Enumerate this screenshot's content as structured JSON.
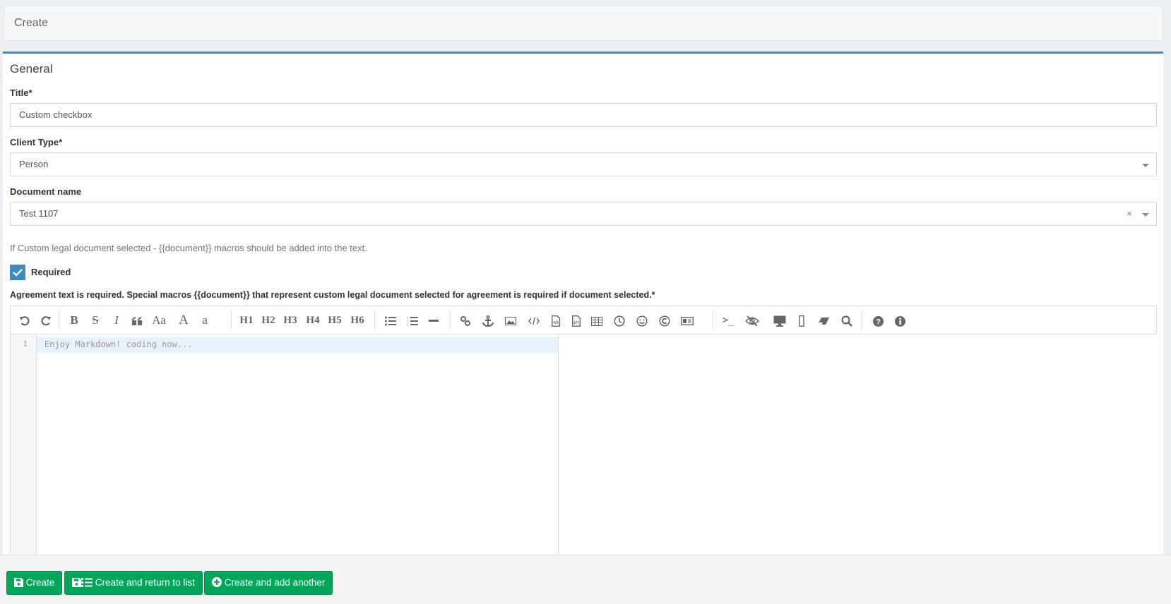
{
  "header": {
    "title": "Create"
  },
  "box": {
    "title": "General"
  },
  "form": {
    "title": {
      "label": "Title*",
      "value": "Custom checkbox"
    },
    "client_type": {
      "label": "Client Type*",
      "value": "Person"
    },
    "document_name": {
      "label": "Document name",
      "value": "Test 1107",
      "clear_glyph": "×",
      "help": "If Custom legal document selected - {{document}} macros should be added into the text."
    },
    "required": {
      "label": "Required",
      "checked": true
    },
    "agreement": {
      "label": "Agreement text is required. Special macros {{document}} that represent custom legal document selected for agreement is required if document selected.*"
    }
  },
  "editor": {
    "toolbar": [
      {
        "name": "undo-icon"
      },
      {
        "name": "redo-icon"
      },
      {
        "name": "bold-icon",
        "text": "B"
      },
      {
        "name": "strikethrough-icon",
        "text": "S"
      },
      {
        "name": "italic-icon",
        "text": "I"
      },
      {
        "name": "quote-icon"
      },
      {
        "name": "uppercase-icon",
        "text": "Aa"
      },
      {
        "name": "ucwords-icon",
        "text": "A"
      },
      {
        "name": "lowercase-icon",
        "text": "a"
      },
      {
        "name": "h1-icon",
        "text": "H1"
      },
      {
        "name": "h2-icon",
        "text": "H2"
      },
      {
        "name": "h3-icon",
        "text": "H3"
      },
      {
        "name": "h4-icon",
        "text": "H4"
      },
      {
        "name": "h5-icon",
        "text": "H5"
      },
      {
        "name": "h6-icon",
        "text": "H6"
      },
      {
        "name": "unordered-list-icon"
      },
      {
        "name": "ordered-list-icon"
      },
      {
        "name": "horizontal-rule-icon"
      },
      {
        "name": "link-icon"
      },
      {
        "name": "anchor-icon"
      },
      {
        "name": "image-icon"
      },
      {
        "name": "inline-code-icon"
      },
      {
        "name": "code-block-icon"
      },
      {
        "name": "preformatted-text-icon"
      },
      {
        "name": "table-icon"
      },
      {
        "name": "datetime-icon"
      },
      {
        "name": "emoji-icon"
      },
      {
        "name": "html-entities-icon"
      },
      {
        "name": "pagebreak-icon"
      },
      {
        "name": "goto-line-icon"
      },
      {
        "name": "watch-toggle-icon"
      },
      {
        "name": "preview-icon"
      },
      {
        "name": "fullscreen-icon"
      },
      {
        "name": "clear-icon"
      },
      {
        "name": "search-icon"
      },
      {
        "name": "help-icon"
      },
      {
        "name": "info-icon"
      }
    ],
    "line_number": "1",
    "placeholder": "Enjoy Markdown! coding now..."
  },
  "footer": {
    "create": "Create",
    "create_return": "Create and return to list",
    "create_another": "Create and add another"
  },
  "colors": {
    "accent": "#3c8dbc",
    "success": "#00a65a"
  }
}
